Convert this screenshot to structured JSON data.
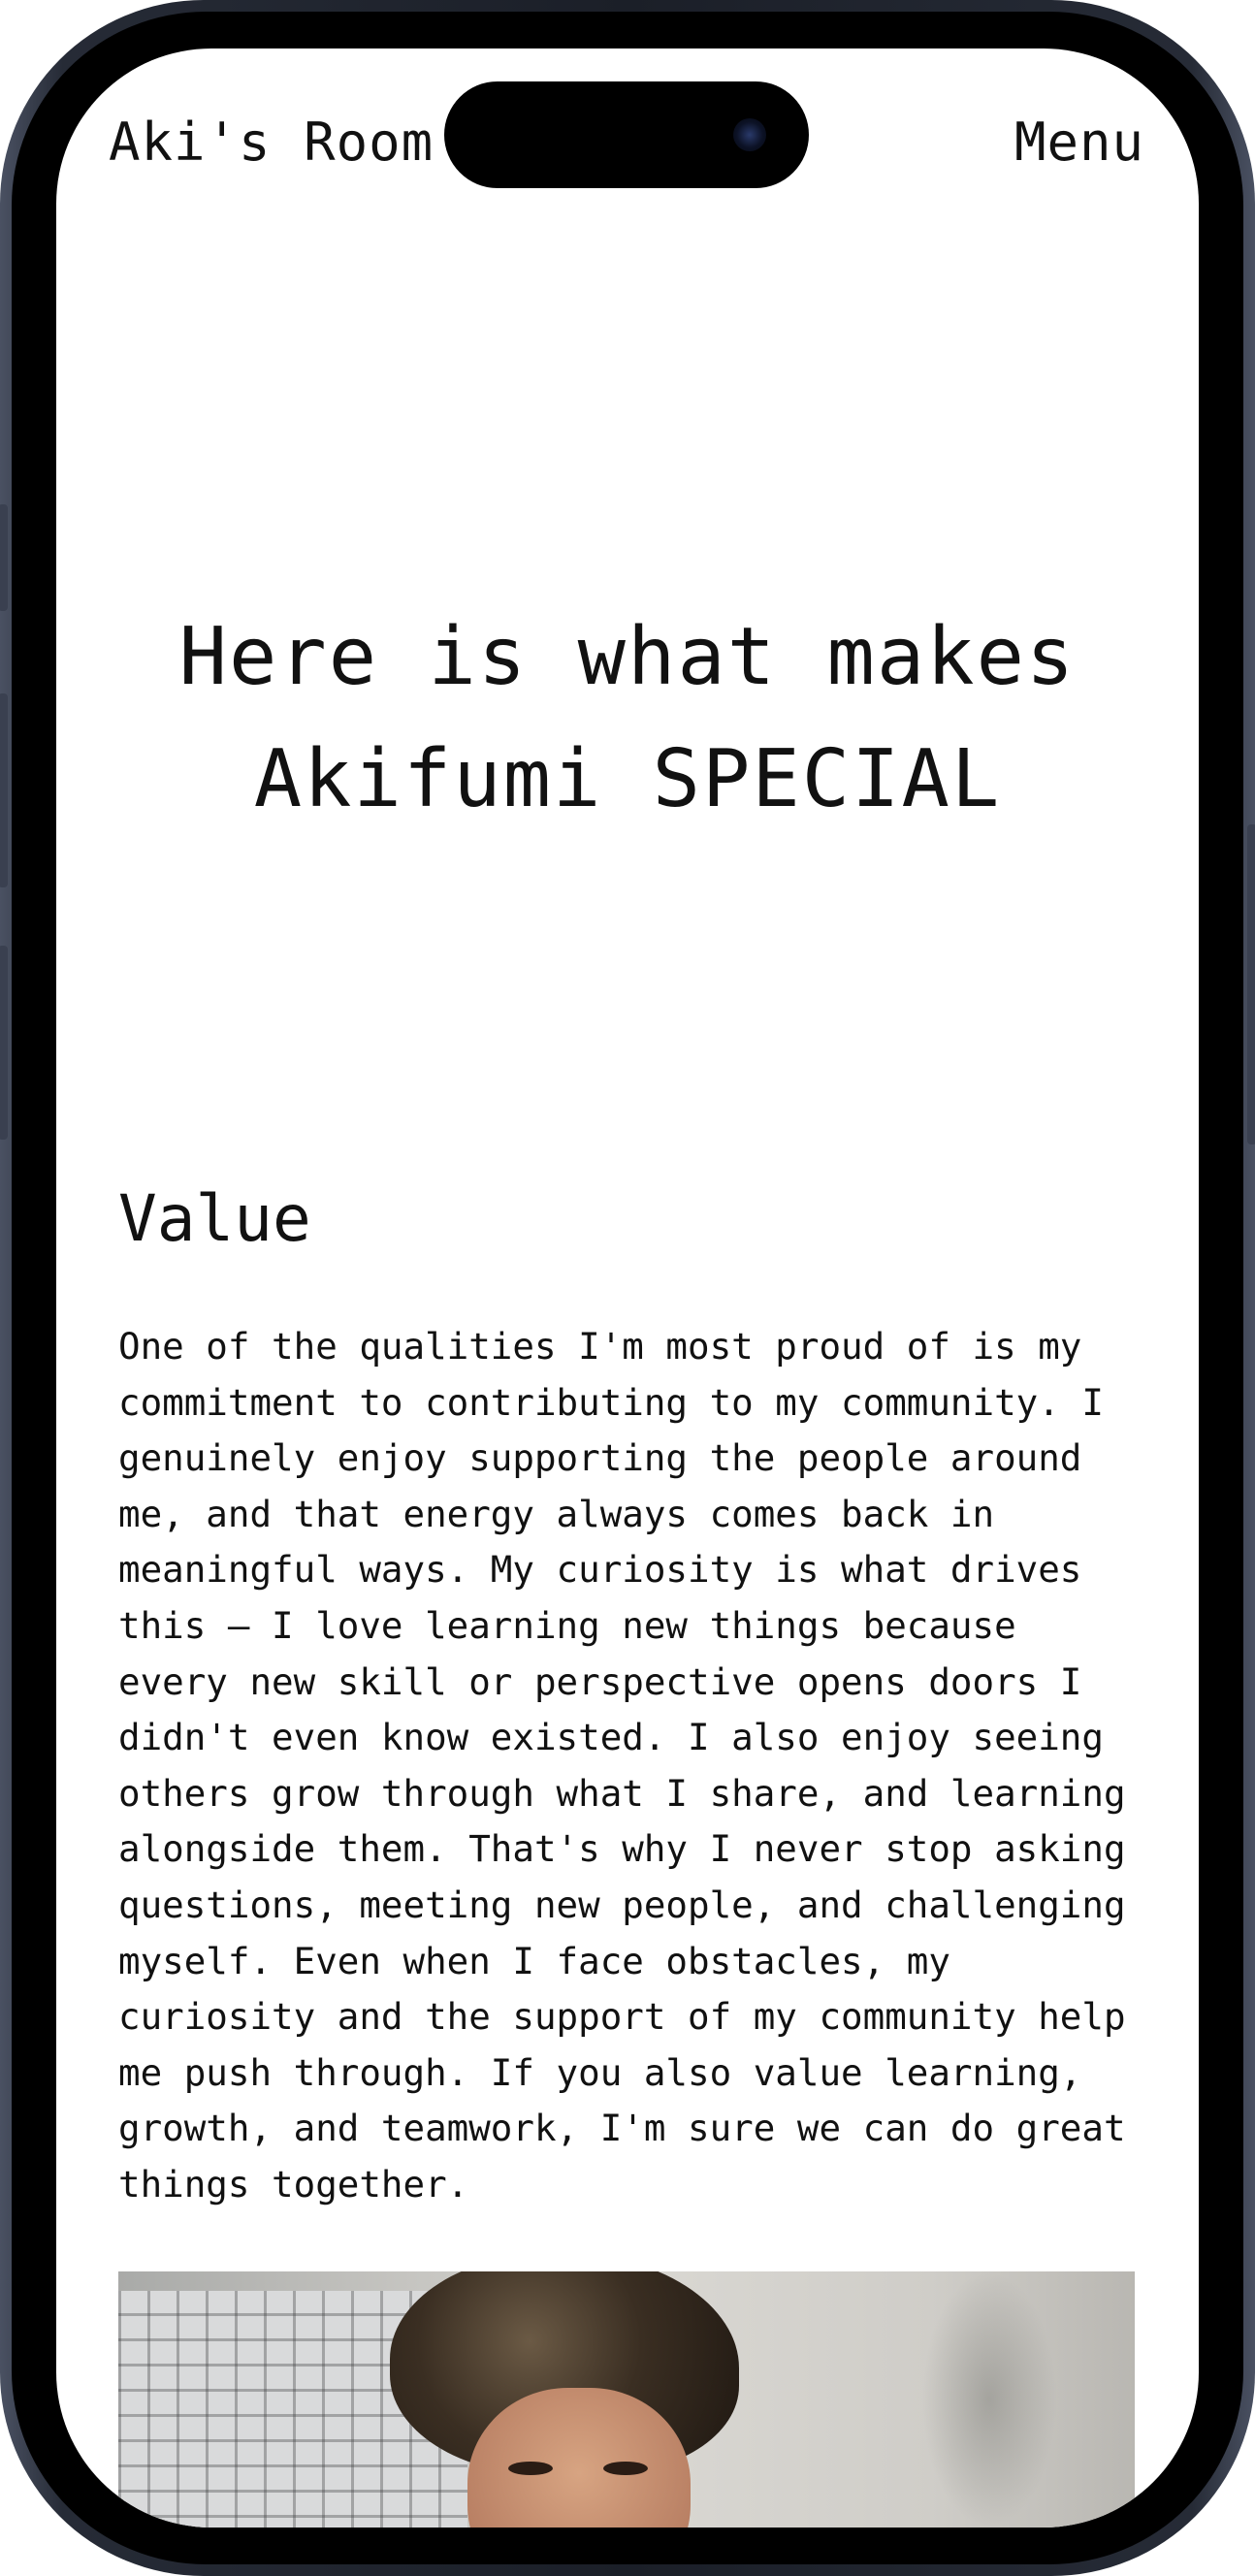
{
  "header": {
    "title": "Aki's Room",
    "menu_label": "Menu"
  },
  "hero": {
    "line1": "Here is what makes",
    "line2": "Akifumi SPECIAL"
  },
  "section": {
    "heading": "Value",
    "body": "One of the qualities I'm most proud of is my commitment to contributing to my community. I genuinely enjoy supporting the people around me, and that energy always comes back in meaningful ways. My curiosity is what drives this — I love learning new things because every new skill or perspective opens doors I didn't even know existed. I also enjoy seeing others grow through what I share, and learning alongside them. That's why I never stop asking questions, meeting new people, and challenging myself. Even when I face obstacles, my curiosity and the support of my community help me push through. If you also value learning, growth, and teamwork, I'm sure we can do great things together."
  },
  "colors": {
    "background": "#ffffff",
    "text": "#111111",
    "frame": "#1b1f28"
  },
  "icons": {
    "camera": "front-camera-icon"
  }
}
